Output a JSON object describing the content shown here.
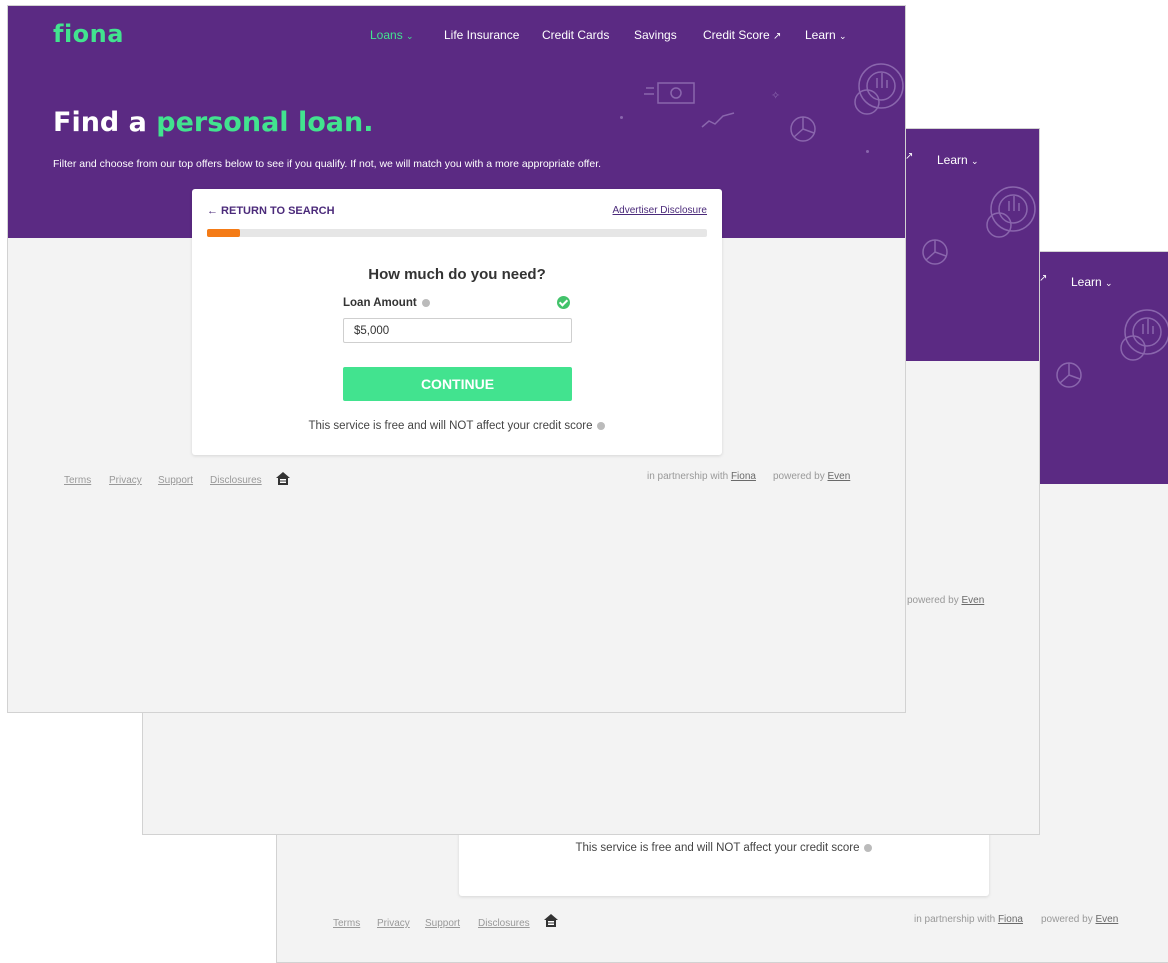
{
  "brand": {
    "logo": "fiona"
  },
  "nav": {
    "items": [
      {
        "label": "Loans",
        "active": true,
        "dropdown": true
      },
      {
        "label": "Life Insurance"
      },
      {
        "label": "Credit Cards"
      },
      {
        "label": "Savings"
      },
      {
        "label": "Credit Score",
        "external": true
      },
      {
        "label": "Learn",
        "dropdown": true
      }
    ]
  },
  "hero": {
    "title_plain": "Find a",
    "title_highlight": "personal loan.",
    "subtitle": "Filter and choose from our top offers below to see if you qualify. If not, we will match you with a more appropriate offer."
  },
  "form": {
    "return_label": "← RETURN TO SEARCH",
    "advertiser_disclosure": "Advertiser Disclosure",
    "progress_fraction": 0.065,
    "question": "How much do you need?",
    "loan_amount_label": "Loan Amount",
    "loan_amount_value": "$5,000",
    "continue_label": "CONTINUE",
    "free_notice": "This service is free and will NOT affect your credit score"
  },
  "footer": {
    "links": [
      "Terms",
      "Privacy",
      "Support",
      "Disclosures"
    ],
    "partnership_prefix": "in partnership with",
    "partner": "Fiona",
    "powered_prefix": "powered by",
    "powered": "Even"
  },
  "colors": {
    "hero_purple": "#5b2a83",
    "accent_green": "#42e38f",
    "progress_orange": "#f47b16",
    "check_green": "#43c36b",
    "page_bg": "#f3f3f3"
  },
  "icons": [
    "chevron-down-icon",
    "external-link-icon",
    "info-icon",
    "checkmark-icon",
    "equal-housing-icon",
    "money-bill-icon",
    "pie-chart-icon",
    "coin-chart-icon"
  ]
}
